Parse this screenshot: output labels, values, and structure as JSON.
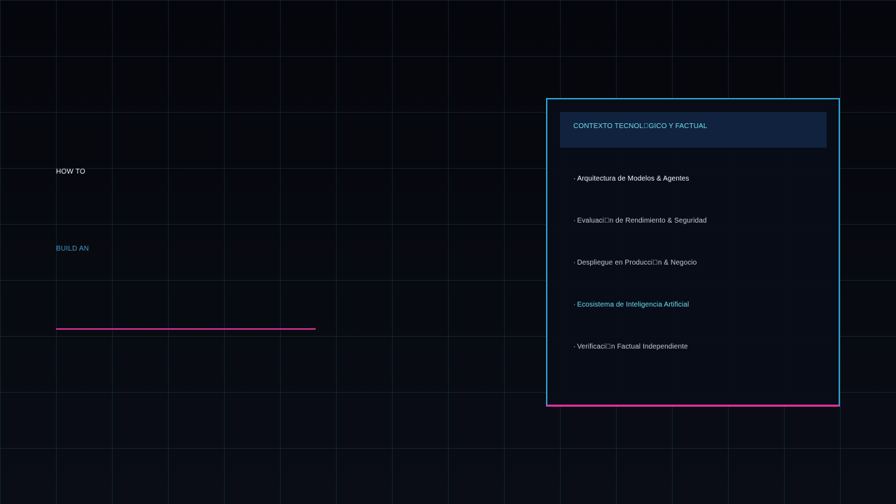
{
  "colors": {
    "background": "#06070c",
    "grid": "#1c4a5e",
    "accent_cyan": "#2e9fcf",
    "accent_magenta": "#e0309a",
    "header_fill": "#10223d",
    "text_light": "#f2f4f8",
    "text_muted": "#c3cad6",
    "text_cyan": "#6fdcf2",
    "text_blue": "#3b9bc9"
  },
  "hero": {
    "line1": "HOW TO",
    "line2": "BUILD AN"
  },
  "panel": {
    "header_title": "CONTEXTO TECNOL\u0000GICO Y FACTUAL",
    "bullet": "·",
    "items": [
      {
        "label": "Arquitectura de Modelos & Agentes"
      },
      {
        "label": "Evaluaci\u0000n de Rendimiento & Seguridad"
      },
      {
        "label": "Despliegue en Producci\u0000n & Negocio"
      },
      {
        "label": "Ecosistema de Inteligencia Artificial"
      },
      {
        "label": "Verificaci\u0000n Factual Independiente"
      }
    ]
  }
}
